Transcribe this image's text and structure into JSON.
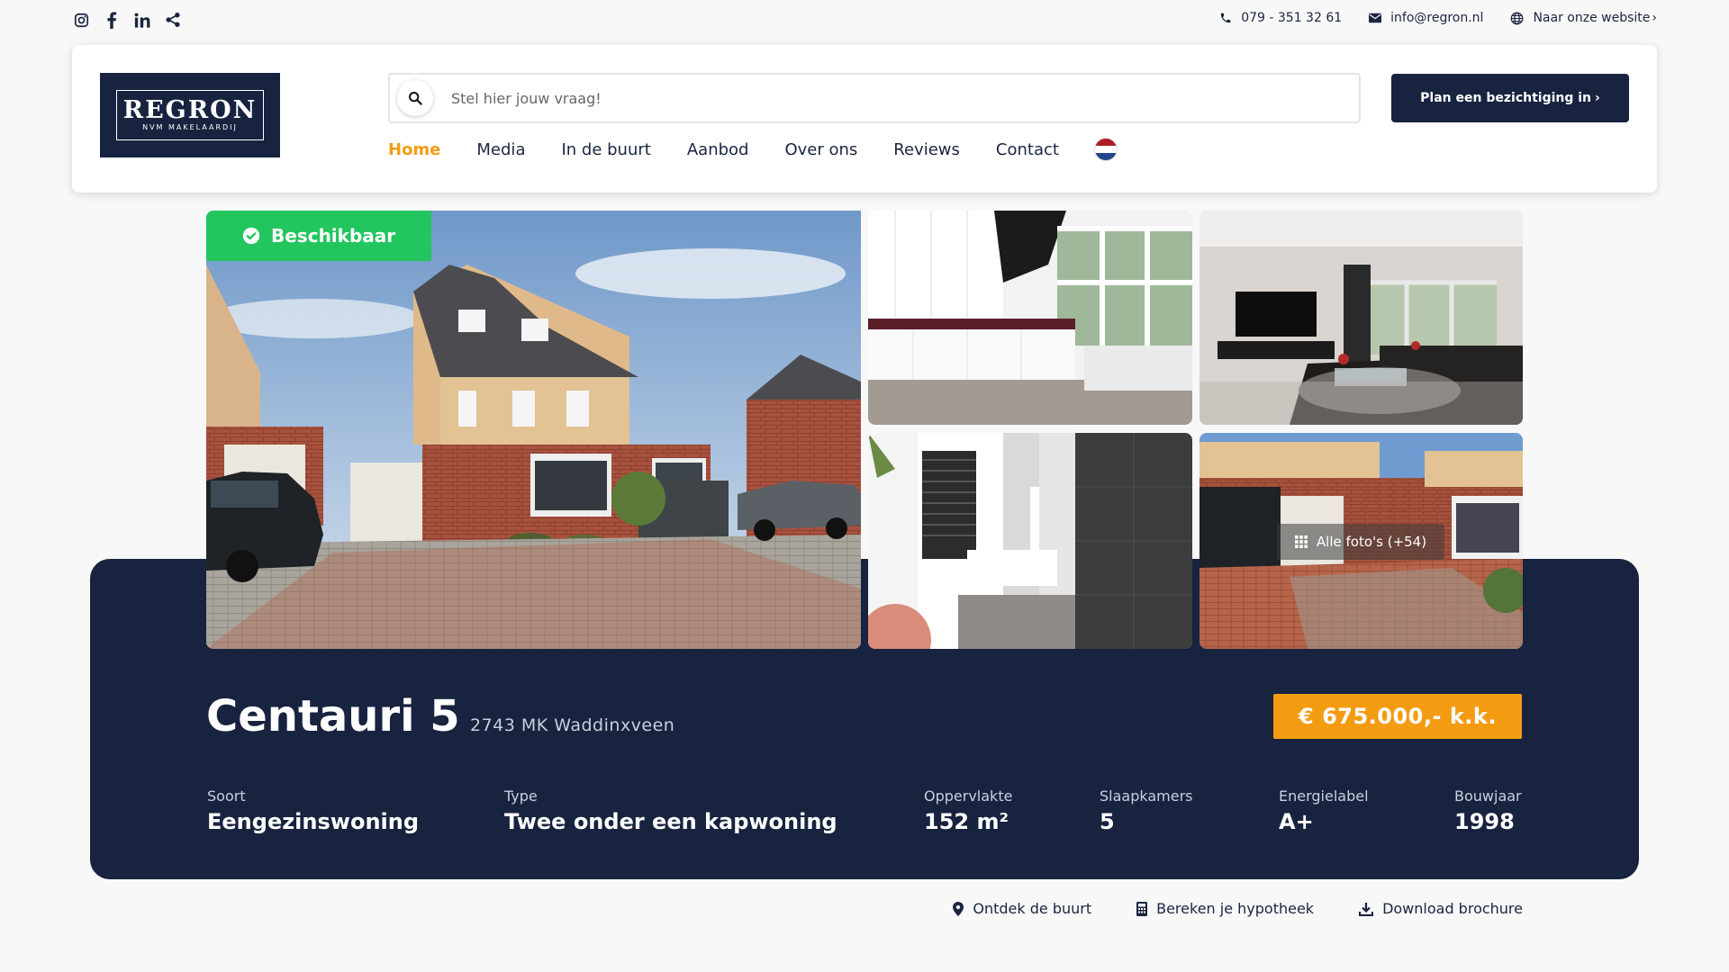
{
  "topbar": {
    "social": [
      "instagram-icon",
      "facebook-icon",
      "linkedin-icon",
      "share-icon"
    ],
    "phone": "079 - 351 32 61",
    "email": "info@regron.nl",
    "website": "Naar onze website"
  },
  "header": {
    "logo_word": "REGRON",
    "logo_sub": "NVM MAKELAARDIJ",
    "search_placeholder": "Stel hier jouw vraag!",
    "cta_label": "Plan een bezichtiging in",
    "nav": [
      "Home",
      "Media",
      "In de buurt",
      "Aanbod",
      "Over ons",
      "Reviews",
      "Contact"
    ],
    "active_nav": "Home",
    "flag_colors": [
      "#ae1c28",
      "#ffffff",
      "#21468b"
    ]
  },
  "listing": {
    "status": "Beschikbaar",
    "all_photos": "Alle foto's (+54)",
    "title": "Centauri 5",
    "address": "2743 MK Waddinxveen",
    "price": "€ 675.000,- k.k.",
    "specs": [
      {
        "label": "Soort",
        "value": "Eengezinswoning"
      },
      {
        "label": "Type",
        "value": "Twee onder een kapwoning"
      },
      {
        "label": "Oppervlakte",
        "value": "152 m²"
      },
      {
        "label": "Slaapkamers",
        "value": "5"
      },
      {
        "label": "Energielabel",
        "value": "A+"
      },
      {
        "label": "Bouwjaar",
        "value": "1998"
      }
    ]
  },
  "actions": {
    "neighborhood": "Ontdek de buurt",
    "mortgage": "Bereken je hypotheek",
    "brochure": "Download brochure"
  },
  "colors": {
    "navy": "#17233f",
    "accent_orange": "#f39c12",
    "available_green": "#22c55e"
  }
}
